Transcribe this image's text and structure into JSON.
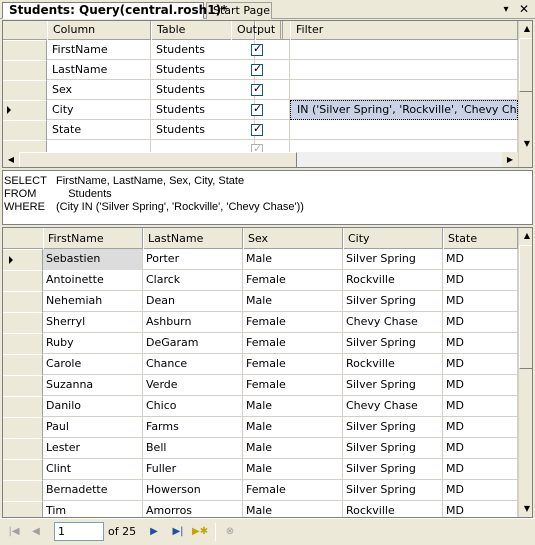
{
  "tabs": [
    {
      "label": "Students: Query(central.rosh1)*",
      "active": true
    },
    {
      "label": "Start Page",
      "active": false
    }
  ],
  "tab_controls": {
    "pin_icon": "dropdown-arrow-icon",
    "close_icon": "close-icon",
    "close_label": "✕",
    "pin_label": "▾"
  },
  "criteria": {
    "headers": [
      "Column",
      "Table",
      "Output",
      "Filter"
    ],
    "rows": [
      {
        "column": "FirstName",
        "table": "Students",
        "output": true,
        "filter": ""
      },
      {
        "column": "LastName",
        "table": "Students",
        "output": true,
        "filter": ""
      },
      {
        "column": "Sex",
        "table": "Students",
        "output": true,
        "filter": ""
      },
      {
        "column": "City",
        "table": "Students",
        "output": true,
        "filter": "IN ('Silver Spring', 'Rockville', 'Chevy Chase')",
        "current": true
      },
      {
        "column": "State",
        "table": "Students",
        "output": true,
        "filter": ""
      },
      {
        "column": "",
        "table": "",
        "output": true,
        "filter": "",
        "disabled": true
      }
    ]
  },
  "sql": {
    "lines": [
      {
        "kw": "SELECT",
        "text": "FirstName, LastName, Sex, City, State"
      },
      {
        "kw": "FROM",
        "text": "    Students"
      },
      {
        "kw": "WHERE",
        "text": "(City IN ('Silver Spring', 'Rockville', 'Chevy Chase'))"
      }
    ]
  },
  "results": {
    "headers": [
      "FirstName",
      "LastName",
      "Sex",
      "City",
      "State"
    ],
    "rows": [
      [
        "Sebastien",
        "Porter",
        "Male",
        "Silver Spring",
        "MD"
      ],
      [
        "Antoinette",
        "Clarck",
        "Female",
        "Rockville",
        "MD"
      ],
      [
        "Nehemiah",
        "Dean",
        "Male",
        "Silver Spring",
        "MD"
      ],
      [
        "Sherryl",
        "Ashburn",
        "Female",
        "Chevy Chase",
        "MD"
      ],
      [
        "Ruby",
        "DeGaram",
        "Female",
        "Silver Spring",
        "MD"
      ],
      [
        "Carole",
        "Chance",
        "Female",
        "Rockville",
        "MD"
      ],
      [
        "Suzanna",
        "Verde",
        "Female",
        "Silver Spring",
        "MD"
      ],
      [
        "Danilo",
        "Chico",
        "Male",
        "Chevy Chase",
        "MD"
      ],
      [
        "Paul",
        "Farms",
        "Male",
        "Silver Spring",
        "MD"
      ],
      [
        "Lester",
        "Bell",
        "Male",
        "Silver Spring",
        "MD"
      ],
      [
        "Clint",
        "Fuller",
        "Male",
        "Silver Spring",
        "MD"
      ],
      [
        "Bernadette",
        "Howerson",
        "Female",
        "Silver Spring",
        "MD"
      ],
      [
        "Tim",
        "Amorros",
        "Male",
        "Rockville",
        "MD"
      ]
    ]
  },
  "navigation": {
    "current_page": "1",
    "of_label": "of 25",
    "icons": {
      "first": "move-first-icon",
      "prev": "move-previous-icon",
      "next": "move-next-icon",
      "last": "move-last-icon",
      "new": "move-new-icon",
      "stop": "stop-icon"
    }
  },
  "colors": {
    "chrome": "#ece9d8",
    "filter_highlight": "#cad3e6",
    "nav_active": "#1d4fa6"
  }
}
